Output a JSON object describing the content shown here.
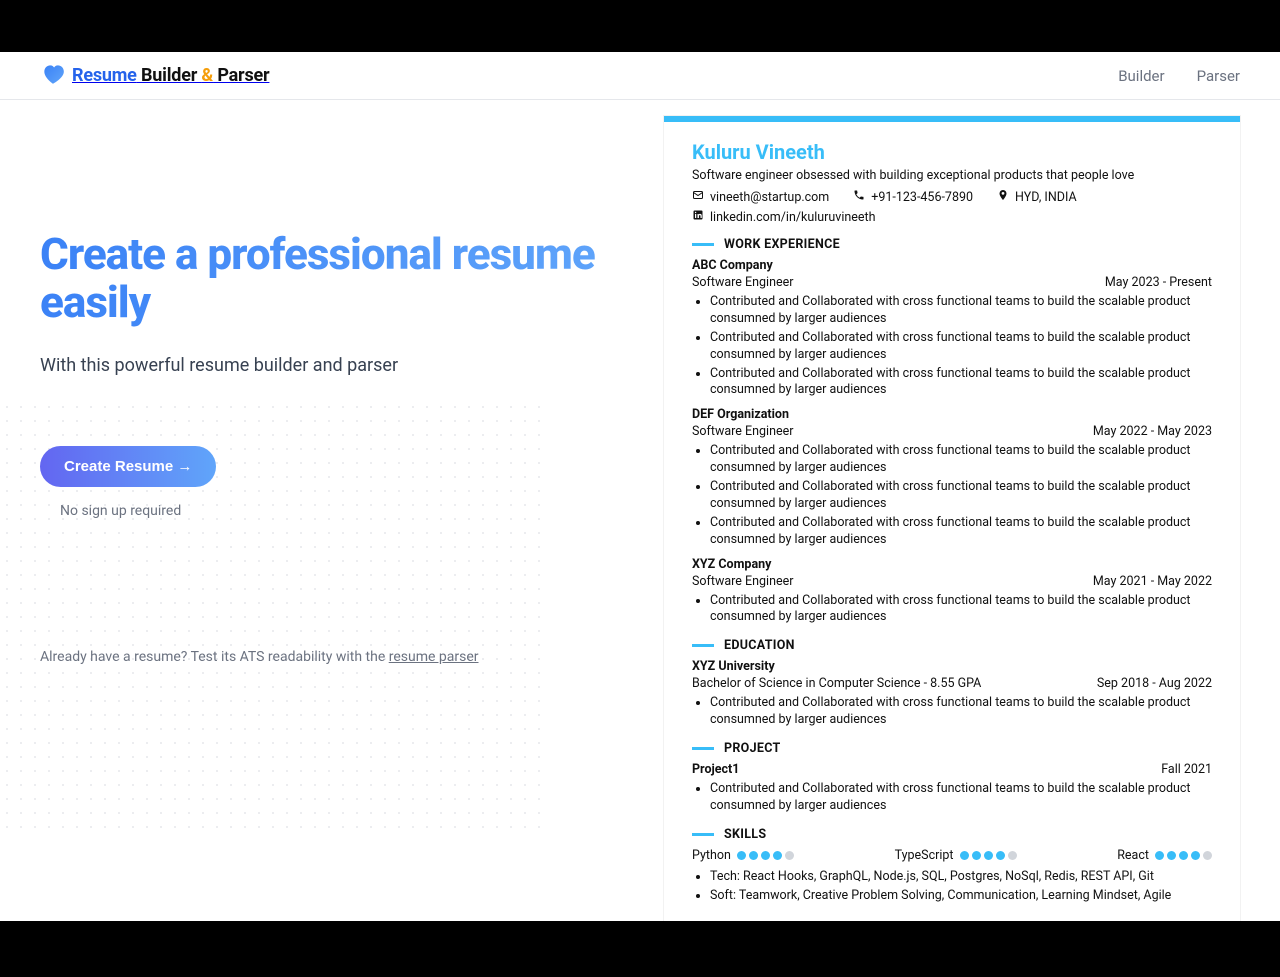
{
  "header": {
    "brand_a": "Resume",
    "brand_b": " Builder ",
    "brand_amp": "&",
    "brand_c": " Parser",
    "nav": {
      "builder": "Builder",
      "parser": "Parser"
    }
  },
  "hero": {
    "headline": "Create a professional resume easily",
    "subhead": "With this powerful resume builder and parser",
    "cta": "Create Resume →",
    "no_signup": "No sign up required",
    "already_prefix": "Already have a resume? Test its ATS readability with the ",
    "already_link": "resume parser"
  },
  "resume": {
    "name": "Kuluru Vineeth",
    "summary": "Software engineer obsessed with building exceptional products that people love",
    "email": "vineeth@startup.com",
    "phone": "+91-123-456-7890",
    "location": "HYD, INDIA",
    "linkedin": "linkedin.com/in/kuluruvineeth",
    "sections": {
      "work": "WORK EXPERIENCE",
      "education": "EDUCATION",
      "project": "PROJECT",
      "skills": "SKILLS"
    },
    "bullet_common": "Contributed and Collaborated with cross functional teams to build the scalable product consumned by larger audiences",
    "work": [
      {
        "company": "ABC Company",
        "title": "Software Engineer",
        "dates": "May 2023 - Present",
        "bullets": 3
      },
      {
        "company": "DEF Organization",
        "title": "Software Engineer",
        "dates": "May 2022 - May 2023",
        "bullets": 3
      },
      {
        "company": "XYZ Company",
        "title": "Software Engineer",
        "dates": "May 2021 - May 2022",
        "bullets": 1
      }
    ],
    "education": {
      "school": "XYZ University",
      "degree": "Bachelor of Science in Computer Science - 8.55 GPA",
      "dates": "Sep 2018 - Aug 2022",
      "bullets": 1
    },
    "project": {
      "name": "Project1",
      "dates": "Fall 2021",
      "bullets": 1
    },
    "skills": {
      "rated": [
        {
          "name": "Python",
          "rating": 4
        },
        {
          "name": "TypeScript",
          "rating": 4
        },
        {
          "name": "React",
          "rating": 4
        }
      ],
      "extra": [
        "Tech: React Hooks, GraphQL, Node.js, SQL, Postgres, NoSql, Redis, REST API, Git",
        "Soft: Teamwork, Creative Problem Solving, Communication, Learning Mindset, Agile"
      ]
    }
  }
}
